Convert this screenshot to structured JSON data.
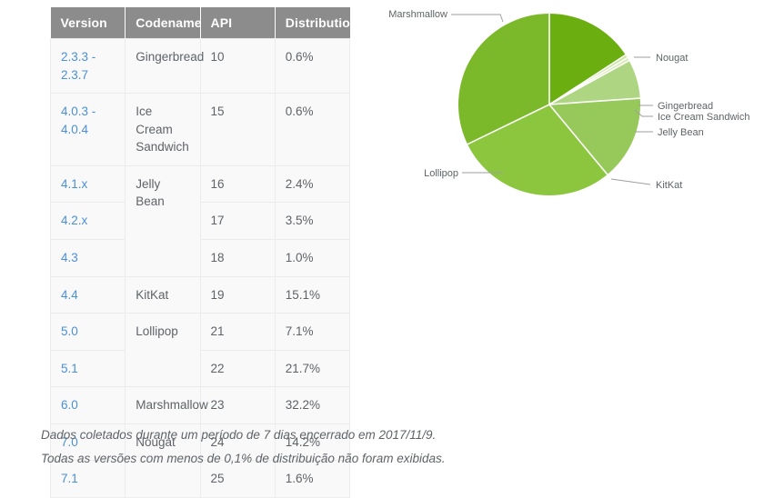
{
  "table": {
    "headers": [
      "Version",
      "Codename",
      "API",
      "Distribution"
    ],
    "rows": [
      {
        "version": "2.3.3 - 2.3.7",
        "codename": "Gingerbread",
        "api": "10",
        "distribution": "0.6%"
      },
      {
        "version": "4.0.3 - 4.0.4",
        "codename": "Ice Cream Sandwich",
        "api": "15",
        "distribution": "0.6%"
      },
      {
        "version": "4.1.x",
        "codename": "Jelly Bean",
        "api": "16",
        "distribution": "2.4%"
      },
      {
        "version": "4.2.x",
        "codename": "",
        "api": "17",
        "distribution": "3.5%"
      },
      {
        "version": "4.3",
        "codename": "",
        "api": "18",
        "distribution": "1.0%"
      },
      {
        "version": "4.4",
        "codename": "KitKat",
        "api": "19",
        "distribution": "15.1%"
      },
      {
        "version": "5.0",
        "codename": "Lollipop",
        "api": "21",
        "distribution": "7.1%"
      },
      {
        "version": "5.1",
        "codename": "",
        "api": "22",
        "distribution": "21.7%"
      },
      {
        "version": "6.0",
        "codename": "Marshmallow",
        "api": "23",
        "distribution": "32.2%"
      },
      {
        "version": "7.0",
        "codename": "Nougat",
        "api": "24",
        "distribution": "14.2%"
      },
      {
        "version": "7.1",
        "codename": "",
        "api": "25",
        "distribution": "1.6%"
      }
    ]
  },
  "footnotes": {
    "line1": "Dados coletados durante um período de 7 dias encerrado em 2017/11/9.",
    "line2": "Todas as versões com menos de 0,1% de distribuição não foram exibidas."
  },
  "chart_data": {
    "type": "pie",
    "title": "",
    "legend_position": "callout-labels",
    "categories": [
      "Nougat",
      "Gingerbread",
      "Ice Cream Sandwich",
      "Jelly Bean",
      "KitKat",
      "Lollipop",
      "Marshmallow"
    ],
    "values": [
      15.8,
      0.6,
      0.6,
      6.9,
      15.1,
      28.8,
      32.2
    ],
    "labels": [
      "Nougat",
      "Gingerbread",
      "Ice Cream Sandwich",
      "Jelly Bean",
      "KitKat",
      "Lollipop",
      "Marshmallow"
    ],
    "colors": [
      "#6aae0f",
      "#c8e6a0",
      "#d4ecb4",
      "#aed581",
      "#96c95a",
      "#8cc63e",
      "#7cb92a"
    ],
    "start_angle_deg": 0,
    "direction": "clockwise"
  },
  "chart_labels": {
    "marshmallow": "Marshmallow",
    "nougat": "Nougat",
    "gingerbread": "Gingerbread",
    "ice_cream_sandwich": "Ice Cream Sandwich",
    "jelly_bean": "Jelly Bean",
    "kitkat": "KitKat",
    "lollipop": "Lollipop"
  }
}
